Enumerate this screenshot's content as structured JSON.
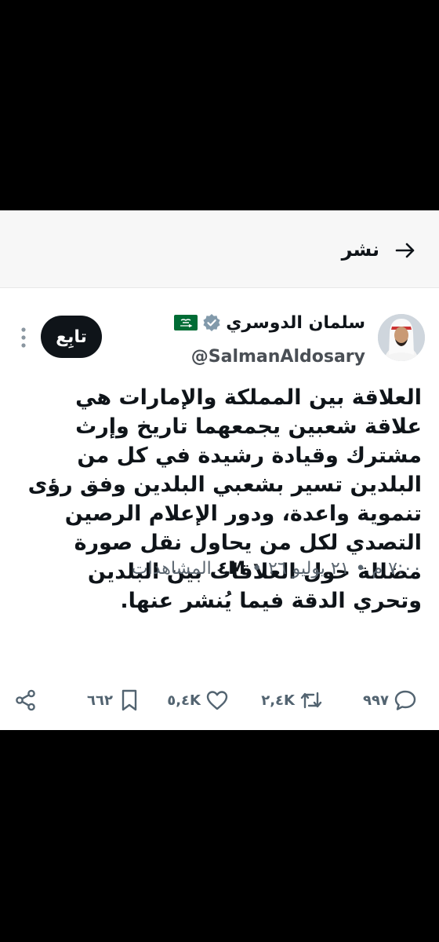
{
  "header": {
    "title": "نشر"
  },
  "tweet": {
    "author_name": "سلمان الدوسري",
    "handle": "@SalmanAldosary",
    "follow_label": "تابِع",
    "text": "العلاقة بين المملكة والإمارات هي علاقة شعبين يجمعهما تاريخ وإرث مشترك وقيادة رشيدة في كل من البلدين تسير بشعبي البلدين وفق رؤى تنموية واعدة، ودور الإعلام الرصين التصدي لكل من يحاول نقل صورة مضللة حول العلاقات بين البلدين وتحري الدقة فيما يُنشر عنها.",
    "time": "٧:٠٠ م",
    "date": "٢١ يوليو ٢٦",
    "views_count": "٤M",
    "views_label": "المشاهدات",
    "replies": "٩٩٧",
    "reposts": "٢,٤K",
    "likes": "٥,٤K",
    "bookmarks": "٦٦٢"
  },
  "icons": {
    "back": "arrow-right-icon",
    "verified": "verified-badge-icon",
    "flag": "saudi-flag-icon",
    "more": "more-vertical-icon",
    "reply": "reply-icon",
    "repost": "repost-icon",
    "like": "heart-icon",
    "bookmark": "bookmark-icon",
    "share": "share-icon"
  },
  "colors": {
    "verified": "#829aab",
    "flag": "#006c35"
  }
}
